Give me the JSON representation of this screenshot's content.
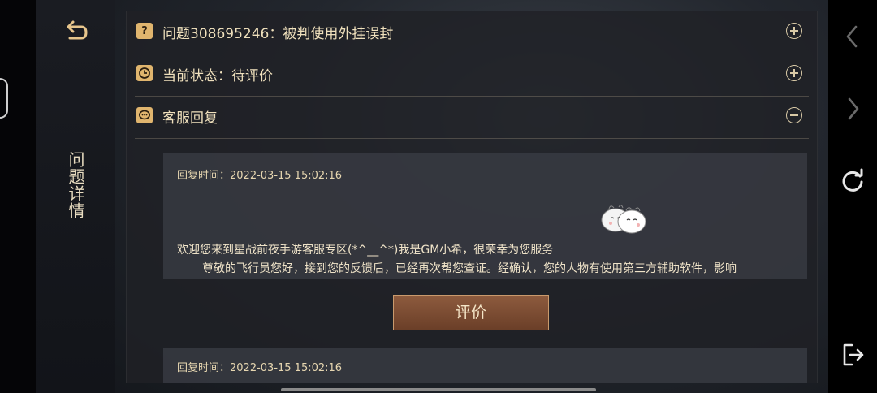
{
  "sidebar": {
    "back_icon": "back-arrow-icon",
    "title": "问题详情"
  },
  "rows": {
    "issue": {
      "icon": "question-icon",
      "icon_glyph": "?",
      "label": "问题308695246：被判使用外挂误封",
      "toggle": "expand-plus-icon"
    },
    "status": {
      "icon": "clock-icon",
      "label": "当前状态：待评价",
      "toggle": "expand-plus-icon"
    },
    "support": {
      "icon": "chat-bubble-icon",
      "label": "客服回复",
      "toggle": "collapse-minus-icon"
    }
  },
  "replies": [
    {
      "time": "回复时间：2022-03-15 15:02:16",
      "line1": "欢迎您来到星战前夜手游客服专区(*^__^*)我是GM小希，很荣幸为您服务",
      "line2": "尊敬的飞行员您好，接到您的反馈后，已经再次帮您查证。经确认，您的人物有使用第三方辅助软件，影响"
    },
    {
      "time": "回复时间：2022-03-15 15:02:16"
    }
  ],
  "rate_button": {
    "label": "评价"
  },
  "system_bar": {
    "icons": [
      "chevron-left-icon",
      "chevron-right-icon",
      "refresh-icon",
      "exit-icon"
    ]
  },
  "colors": {
    "accent_gold": "#e0b56e",
    "button_brown": "#7a4a30",
    "text_cream": "#efe0bc"
  }
}
